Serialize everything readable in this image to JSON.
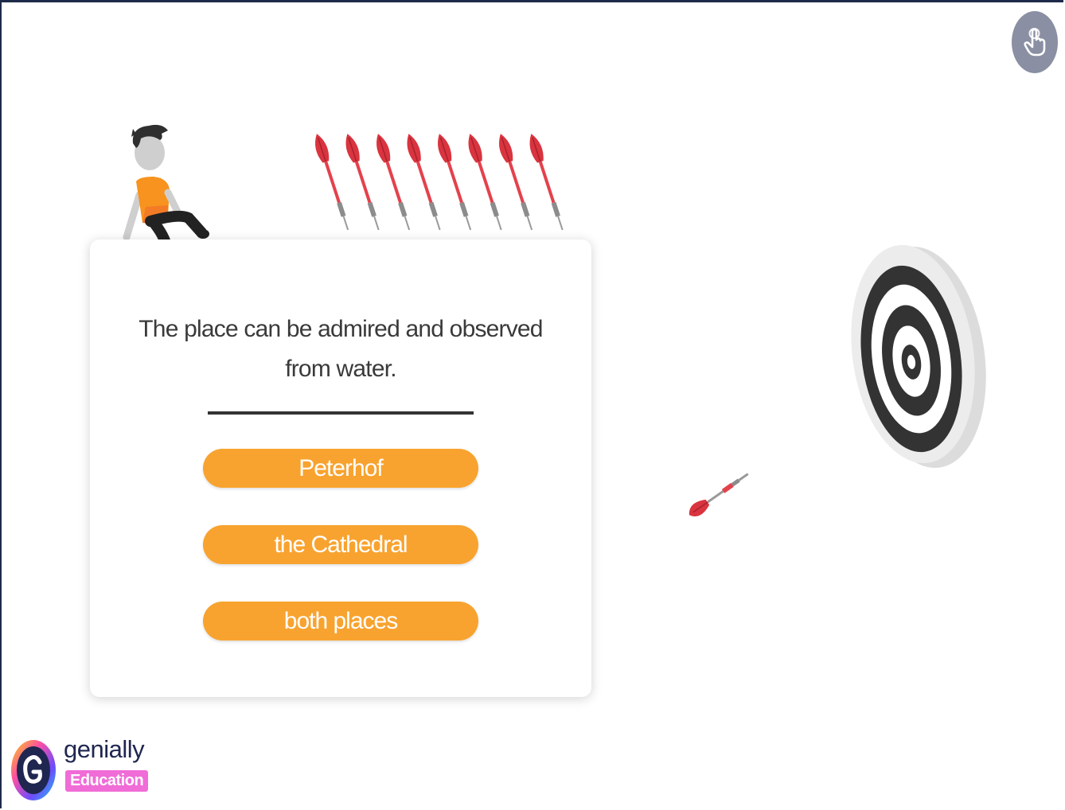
{
  "question": {
    "text": "The place can be admired and observed from water."
  },
  "answers": [
    {
      "label": "Peterhof"
    },
    {
      "label": "the Cathedral"
    },
    {
      "label": "both places"
    }
  ],
  "branding": {
    "name": "genially",
    "badge": "Education"
  },
  "icons": {
    "touch": "hand-pointer-icon",
    "darts_remaining": 8
  },
  "colors": {
    "answer_bg": "#f8a32f",
    "dart_red": "#d9343f",
    "badge_pink": "#f06cd7",
    "touch_button": "#8a8fa3"
  }
}
